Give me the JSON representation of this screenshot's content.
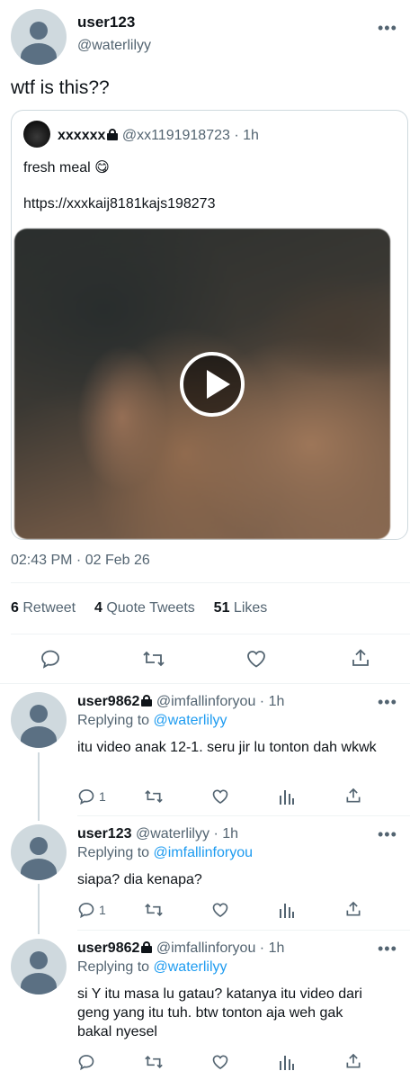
{
  "tweet": {
    "author_name": "user123",
    "author_handle": "@waterlilyy",
    "text": "wtf is this??",
    "timestamp": "02:43 PM · 02 Feb 26",
    "stats": {
      "retweets_count": "6",
      "retweets_label": "Retweet",
      "quotes_count": "4",
      "quotes_label": "Quote Tweets",
      "likes_count": "51",
      "likes_label": "Likes"
    }
  },
  "quoted": {
    "author_name": "xxxxxx",
    "author_handle": "@xx1191918723",
    "time": "· 1h",
    "text": "fresh meal 😋",
    "url": "https://xxxkaij8181kajs198273"
  },
  "replies": [
    {
      "author_name": "user9862",
      "locked": true,
      "author_handle": "@imfallinforyou",
      "time": "· 1h",
      "replying_prefix": "Replying to",
      "replying_to": "@waterlilyy",
      "text": "itu video anak 12-1. seru jir lu tonton dah wkwk",
      "reply_count": "1"
    },
    {
      "author_name": "user123",
      "locked": false,
      "author_handle": "@waterlilyy",
      "time": "· 1h",
      "replying_prefix": "Replying to",
      "replying_to": "@imfallinforyou",
      "text": "siapa? dia kenapa?",
      "reply_count": "1"
    },
    {
      "author_name": "user9862",
      "locked": true,
      "author_handle": "@imfallinforyou",
      "time": "· 1h",
      "replying_prefix": "Replying to",
      "replying_to": "@waterlilyy",
      "text": "si Y itu masa lu gatau? katanya itu video dari geng yang itu tuh. btw tonton aja weh gak bakal nyesel",
      "reply_count": ""
    }
  ],
  "colors": {
    "link": "#1d9bf0",
    "muted": "#536471",
    "text": "#0f1419"
  }
}
